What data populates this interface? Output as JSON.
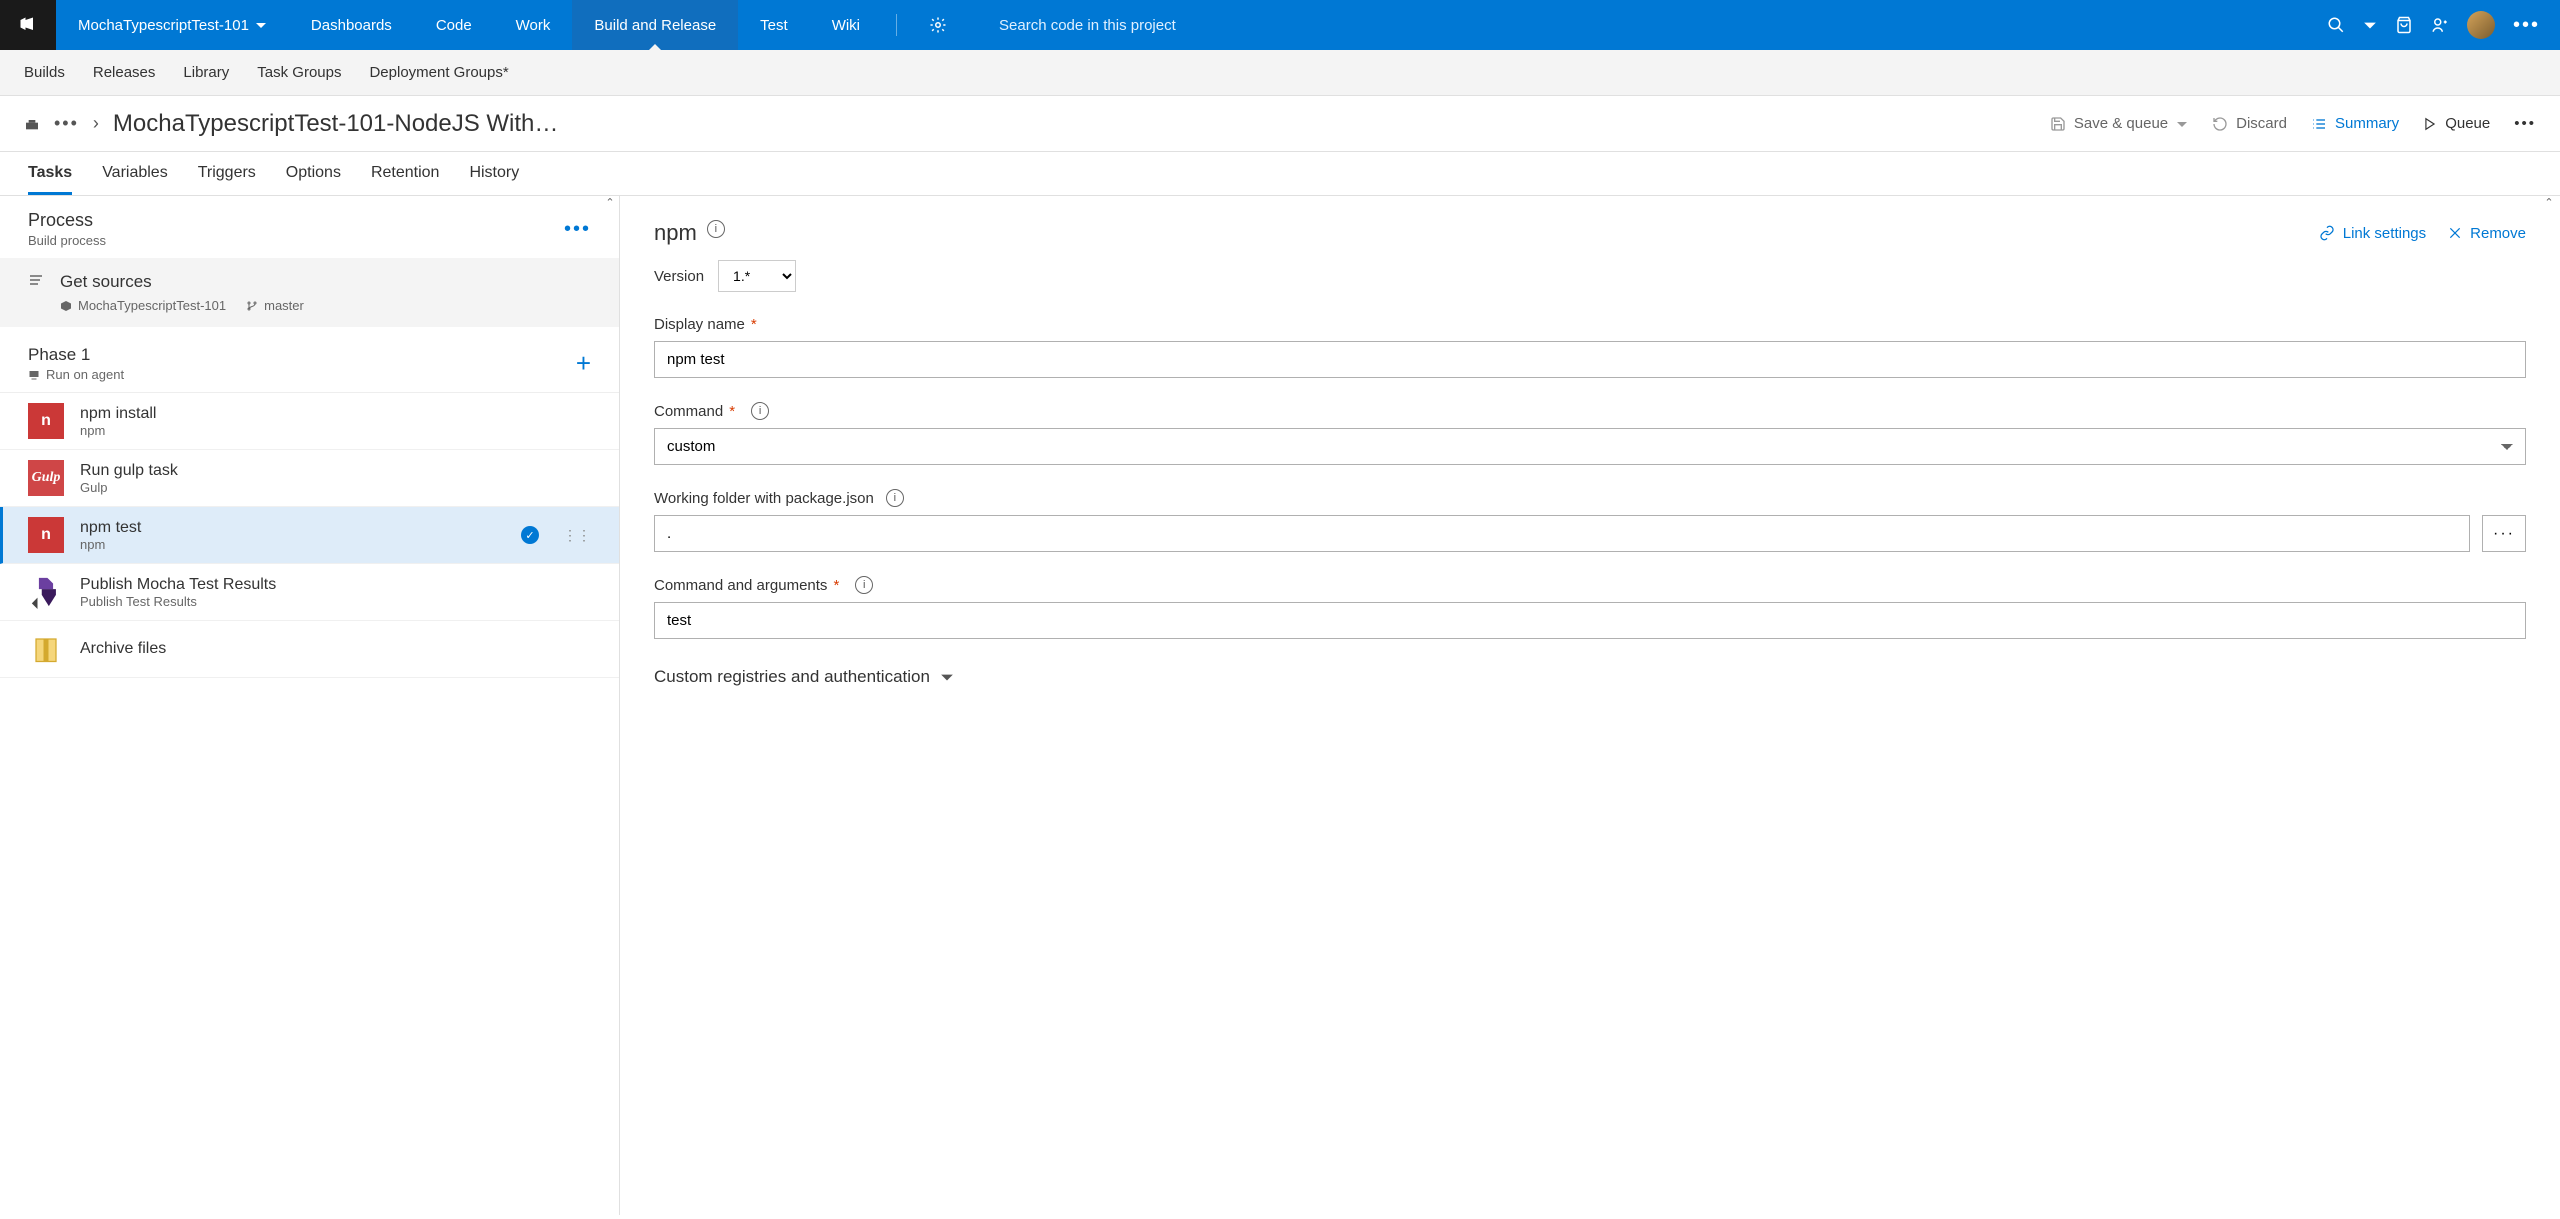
{
  "topbar": {
    "project": "MochaTypescriptTest-101",
    "nav": [
      "Dashboards",
      "Code",
      "Work",
      "Build and Release",
      "Test",
      "Wiki"
    ],
    "nav_active": 3,
    "search_placeholder": "Search code in this project"
  },
  "subnav": [
    "Builds",
    "Releases",
    "Library",
    "Task Groups",
    "Deployment Groups*"
  ],
  "titlebar": {
    "title": "MochaTypescriptTest-101-NodeJS With…",
    "actions": {
      "save": "Save & queue",
      "discard": "Discard",
      "summary": "Summary",
      "queue": "Queue"
    }
  },
  "tabs": [
    "Tasks",
    "Variables",
    "Triggers",
    "Options",
    "Retention",
    "History"
  ],
  "tabs_active": 0,
  "process": {
    "title": "Process",
    "sub": "Build process"
  },
  "sources": {
    "title": "Get sources",
    "repo": "MochaTypescriptTest-101",
    "branch": "master"
  },
  "phase": {
    "title": "Phase 1",
    "sub": "Run on agent"
  },
  "tasks": [
    {
      "name": "npm install",
      "type": "npm",
      "kind": "npm"
    },
    {
      "name": "Run gulp task",
      "type": "Gulp",
      "kind": "gulp"
    },
    {
      "name": "npm test",
      "type": "npm",
      "kind": "npm",
      "selected": true
    },
    {
      "name": "Publish Mocha Test Results",
      "type": "Publish Test Results",
      "kind": "publish"
    },
    {
      "name": "Archive files",
      "type": "",
      "kind": "archive"
    }
  ],
  "form": {
    "heading": "npm",
    "link_settings": "Link settings",
    "remove": "Remove",
    "version_label": "Version",
    "version_value": "1.*",
    "display_name_label": "Display name",
    "display_name_value": "npm test",
    "command_label": "Command",
    "command_value": "custom",
    "folder_label": "Working folder with package.json",
    "folder_value": ".",
    "args_label": "Command and arguments",
    "args_value": "test",
    "collapsible": "Custom registries and authentication"
  }
}
